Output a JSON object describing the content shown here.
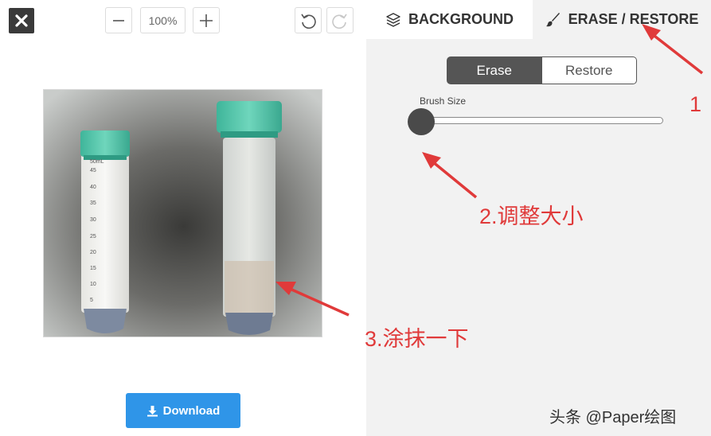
{
  "toolbar": {
    "zoom_value": "100%",
    "close_icon": "close-icon",
    "zoom_out_icon": "minus-icon",
    "zoom_in_icon": "plus-icon",
    "undo_icon": "undo-icon",
    "redo_icon": "redo-icon"
  },
  "tabs": [
    {
      "label": "BACKGROUND",
      "icon": "layers-icon",
      "active": false
    },
    {
      "label": "ERASE / RESTORE",
      "icon": "brush-icon",
      "active": true
    }
  ],
  "mode_toggle": {
    "options": [
      "Erase",
      "Restore"
    ],
    "selected": "Erase"
  },
  "brush": {
    "label": "Brush Size",
    "level": 0
  },
  "image": {
    "tube_left_labels": [
      "50mL",
      "45",
      "40",
      "35",
      "30",
      "25",
      "20",
      "15",
      "10",
      "5"
    ]
  },
  "download": {
    "label": "Download",
    "icon": "download-icon",
    "color": "#2f95e8"
  },
  "annotations": {
    "step1": "1",
    "step2": "2.调整大小",
    "step3": "3.涂抹一下",
    "color": "#e03a3a"
  },
  "watermark": "头条 @Paper绘图"
}
